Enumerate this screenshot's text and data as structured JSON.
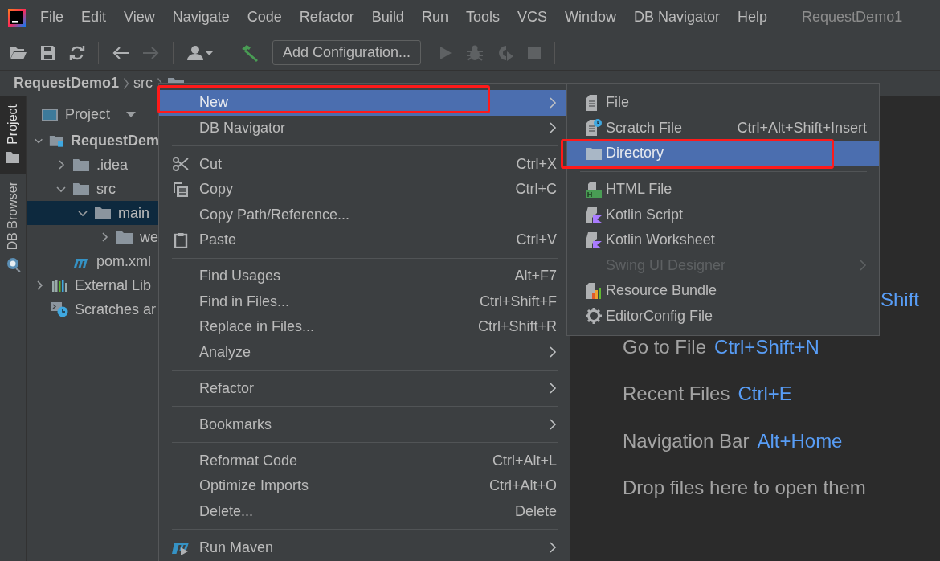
{
  "menu_bar": {
    "items": [
      "File",
      "Edit",
      "View",
      "Navigate",
      "Code",
      "Refactor",
      "Build",
      "Run",
      "Tools",
      "VCS",
      "Window",
      "DB Navigator",
      "Help"
    ],
    "project_title": "RequestDemo1"
  },
  "toolbar": {
    "run_configuration": "Add Configuration..."
  },
  "breadcrumb": [
    "RequestDemo1",
    "src"
  ],
  "tool_strip": [
    {
      "label": "Project",
      "selected": true
    },
    {
      "label": "DB Browser",
      "selected": false
    }
  ],
  "project_panel": {
    "title": "Project",
    "tree": [
      {
        "kind": "module",
        "label": "RequestDem",
        "expanded": true,
        "selected": false,
        "children": [
          {
            "kind": "folder",
            "label": ".idea",
            "expanded": false,
            "selected": false
          },
          {
            "kind": "folder",
            "label": "src",
            "expanded": true,
            "selected": false,
            "children": [
              {
                "kind": "folder",
                "label": "main",
                "expanded": true,
                "selected": true,
                "children": [
                  {
                    "kind": "folder",
                    "label": "we",
                    "expanded": false,
                    "selected": false
                  }
                ]
              }
            ]
          },
          {
            "kind": "maven",
            "label": "pom.xml",
            "selected": false
          }
        ]
      },
      {
        "kind": "libraries",
        "label": "External Lib",
        "expanded": false,
        "selected": false
      },
      {
        "kind": "scratches",
        "label": "Scratches ar",
        "selected": false
      }
    ]
  },
  "editor_hints": [
    {
      "shortcut": "Shift"
    },
    {
      "label": "Go to File",
      "shortcut": "Ctrl+Shift+N"
    },
    {
      "label": "Recent Files",
      "shortcut": "Ctrl+E"
    },
    {
      "label": "Navigation Bar",
      "shortcut": "Alt+Home"
    },
    {
      "label": "Drop files here to open them"
    }
  ],
  "context_menu": {
    "groups": [
      [
        {
          "label": "New",
          "has_submenu": true,
          "selected": true,
          "highlighted": true
        },
        {
          "label": "DB Navigator",
          "has_submenu": true,
          "selected": false,
          "highlighted": false
        }
      ],
      [
        {
          "label": "Cut",
          "shortcut": "Ctrl+X",
          "has_submenu": false,
          "selected": false,
          "highlighted": false
        },
        {
          "label": "Copy",
          "shortcut": "Ctrl+C",
          "has_submenu": false,
          "selected": false,
          "highlighted": false
        },
        {
          "label": "Copy Path/Reference...",
          "has_submenu": false,
          "selected": false,
          "highlighted": false
        },
        {
          "label": "Paste",
          "shortcut": "Ctrl+V",
          "has_submenu": false,
          "selected": false,
          "highlighted": false
        }
      ],
      [
        {
          "label": "Find Usages",
          "shortcut": "Alt+F7",
          "has_submenu": false,
          "selected": false,
          "highlighted": false
        },
        {
          "label": "Find in Files...",
          "shortcut": "Ctrl+Shift+F",
          "has_submenu": false,
          "selected": false,
          "highlighted": false
        },
        {
          "label": "Replace in Files...",
          "shortcut": "Ctrl+Shift+R",
          "has_submenu": false,
          "selected": false,
          "highlighted": false
        },
        {
          "label": "Analyze",
          "has_submenu": true,
          "selected": false,
          "highlighted": false
        }
      ],
      [
        {
          "label": "Refactor",
          "has_submenu": true,
          "selected": false,
          "highlighted": false
        }
      ],
      [
        {
          "label": "Bookmarks",
          "has_submenu": true,
          "selected": false,
          "highlighted": false
        }
      ],
      [
        {
          "label": "Reformat Code",
          "shortcut": "Ctrl+Alt+L",
          "has_submenu": false,
          "selected": false,
          "highlighted": false
        },
        {
          "label": "Optimize Imports",
          "shortcut": "Ctrl+Alt+O",
          "has_submenu": false,
          "selected": false,
          "highlighted": false
        },
        {
          "label": "Delete...",
          "shortcut": "Delete",
          "has_submenu": false,
          "selected": false,
          "highlighted": false
        }
      ],
      [
        {
          "label": "Run Maven",
          "has_submenu": true,
          "selected": false,
          "highlighted": false
        }
      ]
    ]
  },
  "new_submenu": {
    "groups": [
      [
        {
          "label": "File",
          "has_submenu": false,
          "selected": false,
          "disabled": false,
          "highlighted": false
        },
        {
          "label": "Scratch File",
          "shortcut": "Ctrl+Alt+Shift+Insert",
          "has_submenu": false,
          "selected": false,
          "disabled": false,
          "highlighted": false
        },
        {
          "label": "Directory",
          "has_submenu": false,
          "selected": true,
          "disabled": false,
          "highlighted": true
        }
      ],
      [
        {
          "label": "HTML File",
          "has_submenu": false,
          "selected": false,
          "disabled": false,
          "highlighted": false
        },
        {
          "label": "Kotlin Script",
          "has_submenu": false,
          "selected": false,
          "disabled": false,
          "highlighted": false
        },
        {
          "label": "Kotlin Worksheet",
          "has_submenu": false,
          "selected": false,
          "disabled": false,
          "highlighted": false
        },
        {
          "label": "Swing UI Designer",
          "has_submenu": true,
          "selected": false,
          "disabled": true,
          "highlighted": false
        },
        {
          "label": "Resource Bundle",
          "has_submenu": false,
          "selected": false,
          "disabled": false,
          "highlighted": false
        },
        {
          "label": "EditorConfig File",
          "has_submenu": false,
          "selected": false,
          "disabled": false,
          "highlighted": false
        }
      ]
    ]
  }
}
